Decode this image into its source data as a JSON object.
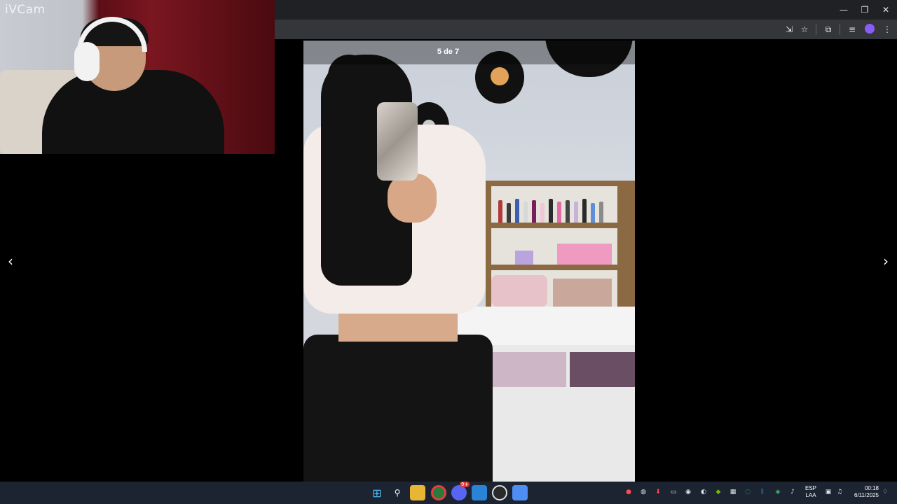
{
  "webcam": {
    "label": "iVCam"
  },
  "viewer": {
    "counter": "5 de 7",
    "prev_icon": "chevron-left-icon",
    "next_icon": "chevron-right-icon"
  },
  "window_controls": {
    "minimize": "—",
    "restore": "❐",
    "close": "✕"
  },
  "toolbar": {
    "icons": [
      "install-app-icon",
      "bookmark-star-icon",
      "extensions-icon",
      "media-controls-icon",
      "profile-avatar-icon",
      "menu-kebab-icon"
    ]
  },
  "taskbar": {
    "apps": [
      "windows-start-icon",
      "search-icon",
      "file-explorer-icon",
      "chrome-icon",
      "discord-icon",
      "file-app-icon",
      "obs-icon",
      "messenger-icon"
    ],
    "discord_badge": "9+",
    "language": {
      "line1": "ESP",
      "line2": "LAA"
    },
    "clock": {
      "time": "00:18",
      "date": "6/11/2025"
    }
  },
  "colors": {
    "taskbar_bg": "#1c2431",
    "chrome_bg": "#202124",
    "accent_blue": "#0078d4"
  }
}
